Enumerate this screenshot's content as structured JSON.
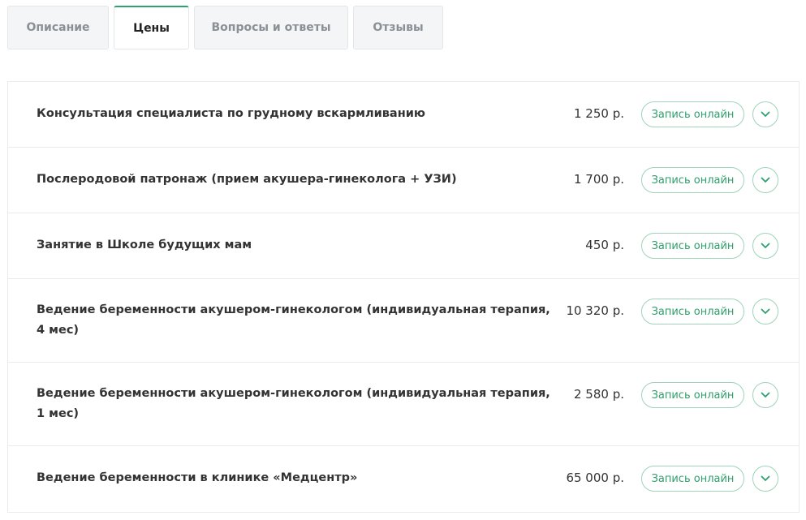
{
  "tabs": [
    {
      "label": "Описание",
      "active": false
    },
    {
      "label": "Цены",
      "active": true
    },
    {
      "label": "Вопросы и ответы",
      "active": false
    },
    {
      "label": "Отзывы",
      "active": false
    }
  ],
  "price_items": [
    {
      "name": "Консультация специалиста по грудному вскармливанию",
      "price": "1 250 р.",
      "button": "Запись онлайн"
    },
    {
      "name": "Послеродовой патронаж (прием акушера-гинеколога + УЗИ)",
      "price": "1 700 р.",
      "button": "Запись онлайн"
    },
    {
      "name": "Занятие в Школе будущих мам",
      "price": "450 р.",
      "button": "Запись онлайн"
    },
    {
      "name": "Ведение беременности акушером-гинекологом (индивидуальная терапия, 4 мес)",
      "price": "10 320 р.",
      "button": "Запись онлайн"
    },
    {
      "name": "Ведение беременности акушером-гинекологом (индивидуальная терапия, 1 мес)",
      "price": "2 580 р.",
      "button": "Запись онлайн"
    },
    {
      "name": "Ведение беременности в клинике «Медцентр»",
      "price": "65 000 р.",
      "button": "Запись онлайн"
    }
  ],
  "icons": {
    "expand": "chevron-down-icon"
  },
  "colors": {
    "accent": "#2ba36f",
    "button_border": "#9fd3ba",
    "button_text": "#2f9e6c"
  }
}
